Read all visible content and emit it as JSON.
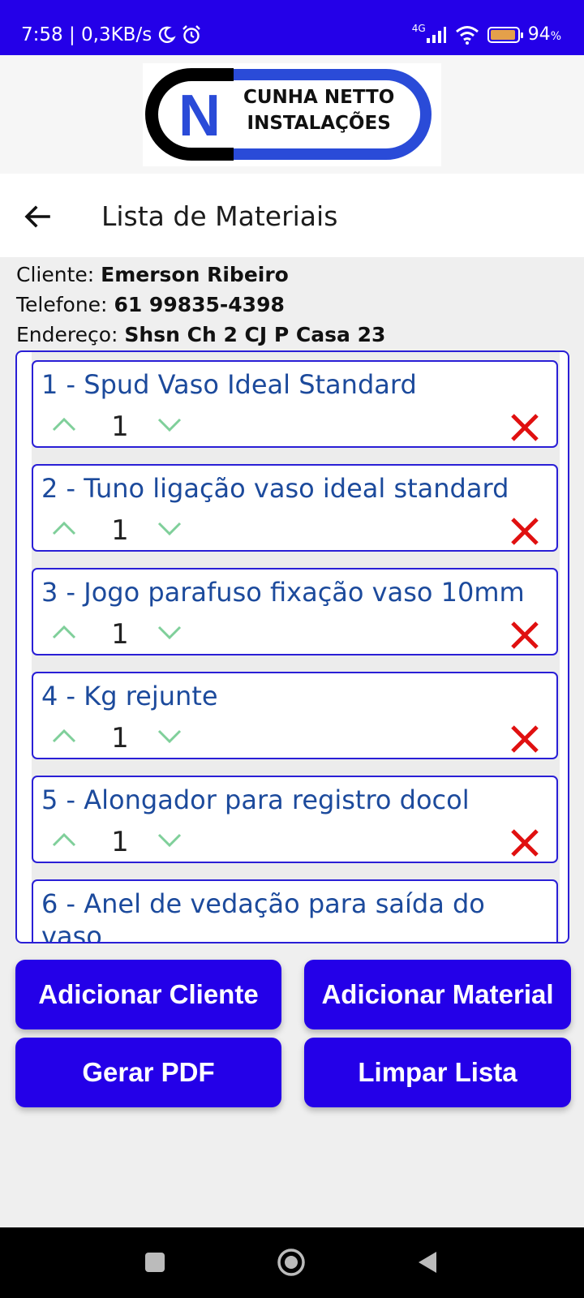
{
  "status": {
    "time_info": "7:58 | 0,3KB/s",
    "network": "4G",
    "battery": "94"
  },
  "logo": {
    "line1": "CUNHA NETTO",
    "line2": "INSTALAÇÕES",
    "letter": "N"
  },
  "app_bar": {
    "title": "Lista de Materiais"
  },
  "client": {
    "name_label": "Cliente:",
    "name": "Emerson Ribeiro",
    "phone_label": "Telefone:",
    "phone": "61 99835-4398",
    "address_label": "Endereço:",
    "address": "Shsn Ch 2 CJ P Casa 23"
  },
  "materials": [
    {
      "name": "1 - Spud Vaso Ideal Standard",
      "qty": "1"
    },
    {
      "name": "2 - Tuno ligação vaso ideal standard",
      "qty": "1"
    },
    {
      "name": "3 - Jogo parafuso fixação vaso 10mm",
      "qty": "1"
    },
    {
      "name": "4 - Kg rejunte",
      "qty": "1"
    },
    {
      "name": "5 - Alongador para registro docol",
      "qty": "1"
    },
    {
      "name": "6 - Anel de vedação para saída do",
      "name_cont": "vaso"
    }
  ],
  "buttons": {
    "add_client": "Adicionar Cliente",
    "add_material": "Adicionar Material",
    "pdf": "Gerar PDF",
    "clear": "Limpar Lista"
  },
  "colors": {
    "primary": "#2400e8",
    "item_text": "#1c4a9c",
    "chevron": "#7fcf9a",
    "delete": "#e01010"
  }
}
